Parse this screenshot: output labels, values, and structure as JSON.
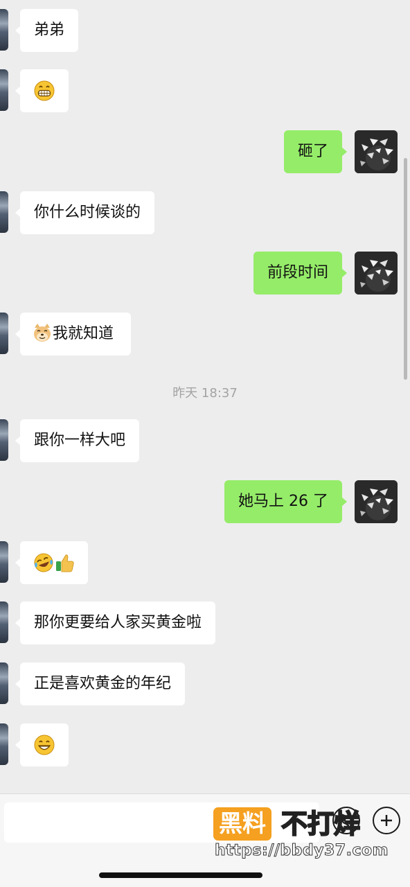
{
  "messages": [
    {
      "side": "left",
      "text": "弟弟"
    },
    {
      "side": "left",
      "emoji": "grin-face"
    },
    {
      "side": "right",
      "text": "砸了"
    },
    {
      "side": "left",
      "text": "你什么时候谈的"
    },
    {
      "side": "right",
      "text": "前段时间"
    },
    {
      "side": "left",
      "emoji": "doge-face",
      "text": "我就知道"
    },
    {
      "side": "left",
      "text": "跟你一样大吧"
    },
    {
      "side": "right",
      "text": "她马上 26 了"
    },
    {
      "side": "left",
      "emoji": "laugh-cry-face-thumbs-up"
    },
    {
      "side": "left",
      "text": "那你更要给人家买黄金啦"
    },
    {
      "side": "left",
      "text": "正是喜欢黄金的年纪"
    },
    {
      "side": "left",
      "emoji": "smile-face"
    }
  ],
  "timestamp": "昨天 18:37",
  "watermark": {
    "tag": "黑料",
    "text": "不打烊",
    "url": "https://bbdy37.com"
  },
  "colors": {
    "background": "#ededed",
    "bubble_self": "#95ec69",
    "bubble_other": "#ffffff",
    "watermark_orange": "#f5a020"
  },
  "icons": [
    "voice-icon",
    "add-icon"
  ]
}
